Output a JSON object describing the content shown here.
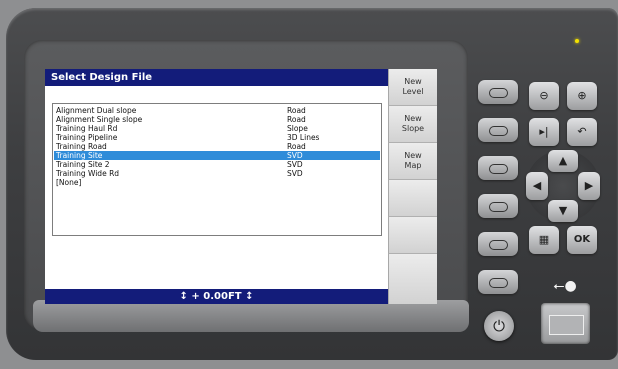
{
  "dialog": {
    "title": "Select Design File",
    "files": [
      {
        "name": "Alignment Dual slope",
        "type": "Road",
        "selected": false
      },
      {
        "name": "Alignment Single slope",
        "type": "Road",
        "selected": false
      },
      {
        "name": "Training Haul Rd",
        "type": "Slope",
        "selected": false
      },
      {
        "name": "Training Pipeline",
        "type": "3D Lines",
        "selected": false
      },
      {
        "name": "Training Road",
        "type": "Road",
        "selected": false
      },
      {
        "name": "Training Site",
        "type": "SVD",
        "selected": true
      },
      {
        "name": "Training Site 2",
        "type": "SVD",
        "selected": false
      },
      {
        "name": "Training Wide Rd",
        "type": "SVD",
        "selected": false
      },
      {
        "name": "[None]",
        "type": "",
        "selected": false
      }
    ],
    "status": "↕ + 0.00FT ↕"
  },
  "softkeys": [
    {
      "label": "New\nLevel"
    },
    {
      "label": "New\nSlope"
    },
    {
      "label": "New\nMap"
    },
    {
      "label": ""
    },
    {
      "label": ""
    },
    {
      "label": ""
    }
  ],
  "colors": {
    "titlebar": "#131c7a",
    "selection": "#2f8cd9",
    "led": "#f4e200"
  },
  "icons": {
    "zoom_out": "zoom-out-icon",
    "zoom_in": "zoom-in-icon",
    "next": "next-page-icon",
    "back": "back-icon",
    "up": "arrow-up-icon",
    "down": "arrow-down-icon",
    "left": "arrow-left-icon",
    "right": "arrow-right-icon",
    "keypad": "keypad-icon",
    "ok": "ok-icon",
    "power": "power-icon",
    "usb": "usb-icon"
  }
}
